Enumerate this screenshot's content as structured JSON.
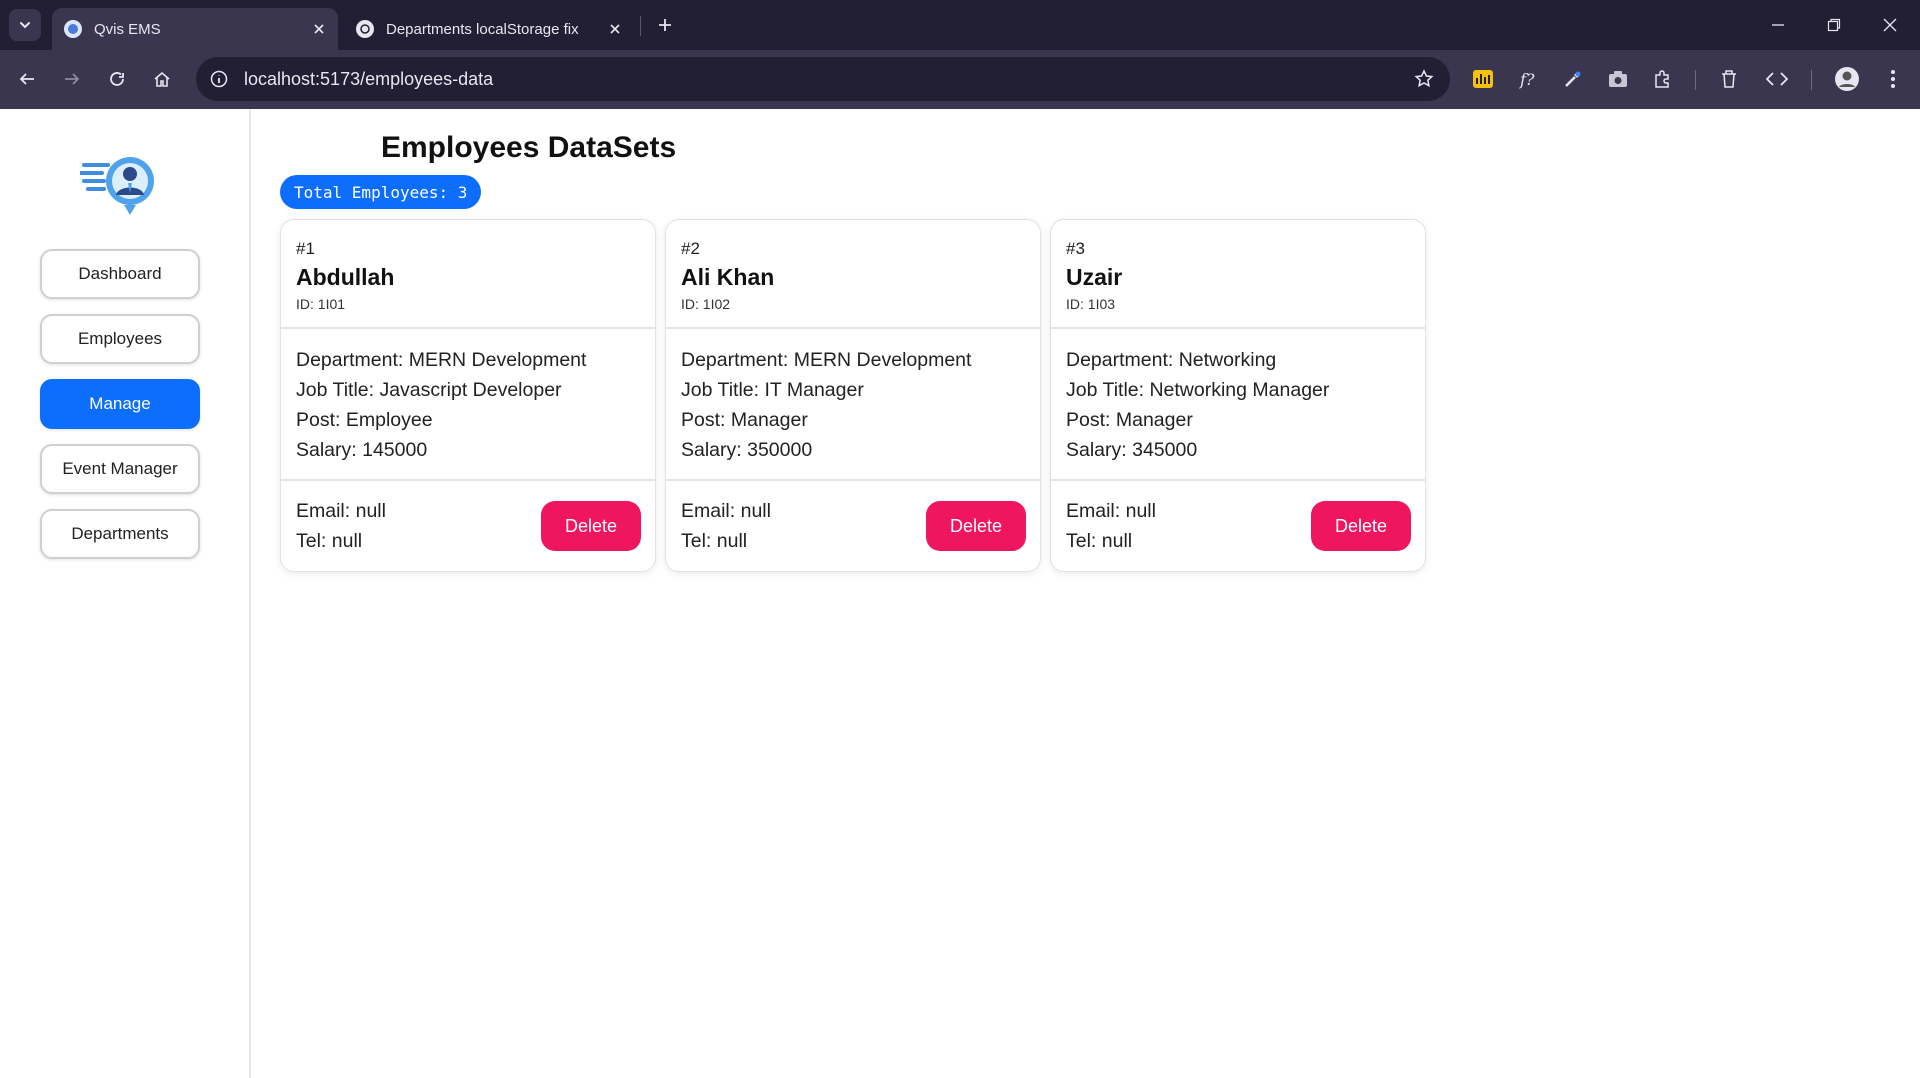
{
  "browser": {
    "tabs": [
      {
        "title": "Qvis EMS",
        "active": true
      },
      {
        "title": "Departments localStorage fix",
        "active": false
      }
    ],
    "url": "localhost:5173/employees-data"
  },
  "sidebar": {
    "items": [
      {
        "label": "Dashboard",
        "active": false
      },
      {
        "label": "Employees",
        "active": false
      },
      {
        "label": "Manage",
        "active": true
      },
      {
        "label": "Event Manager",
        "active": false
      },
      {
        "label": "Departments",
        "active": false
      }
    ]
  },
  "main": {
    "title": "Employees DataSets",
    "total_badge": "Total Employees: 3"
  },
  "employees": [
    {
      "num": "#1",
      "name": "Abdullah",
      "id": "ID: 1I01",
      "department": "Department: MERN Development",
      "job_title": "Job Title: Javascript Developer",
      "post": "Post: Employee",
      "salary": "Salary: 145000",
      "email": "Email: null",
      "tel": "Tel: null",
      "delete_label": "Delete"
    },
    {
      "num": "#2",
      "name": "Ali Khan",
      "id": "ID: 1I02",
      "department": "Department: MERN Development",
      "job_title": "Job Title: IT Manager",
      "post": "Post: Manager",
      "salary": "Salary: 350000",
      "email": "Email: null",
      "tel": "Tel: null",
      "delete_label": "Delete"
    },
    {
      "num": "#3",
      "name": "Uzair",
      "id": "ID: 1I03",
      "department": "Department: Networking",
      "job_title": "Job Title: Networking Manager",
      "post": "Post: Manager",
      "salary": "Salary: 345000",
      "email": "Email: null",
      "tel": "Tel: null",
      "delete_label": "Delete"
    }
  ],
  "colors": {
    "primary": "#0d6efd",
    "danger": "#f0155f",
    "chrome_dark": "#221e33",
    "chrome_mid": "#3b3650"
  }
}
